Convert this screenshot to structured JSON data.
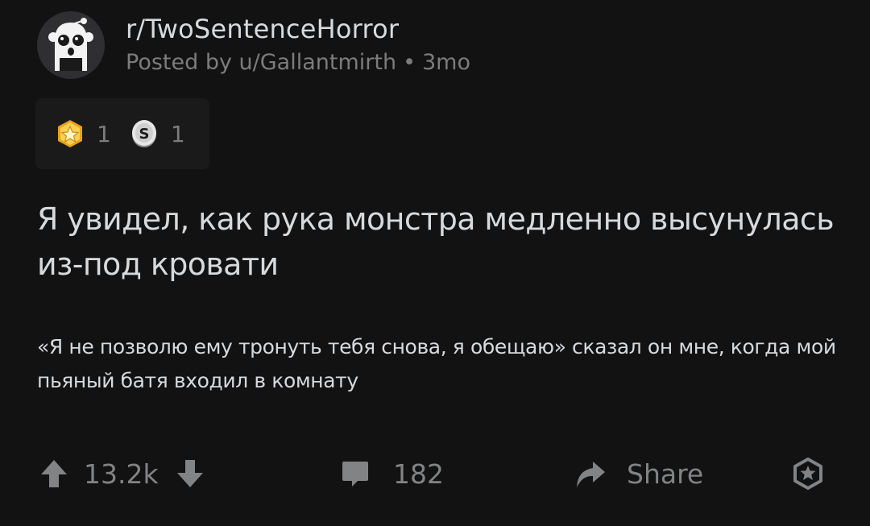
{
  "header": {
    "subreddit": "r/TwoSentenceHorror",
    "posted_by": "Posted by u/Gallantmirth",
    "separator": "•",
    "age": "3mo"
  },
  "awards": [
    {
      "icon": "star-award-icon",
      "count": "1"
    },
    {
      "icon": "silver-coin-award-icon",
      "count": "1"
    }
  ],
  "post": {
    "title": "Я увидел, как рука монстра медленно высунулась из-под кровати",
    "body": "«Я не позволю ему тронуть тебя снова, я обещаю» сказал он мне, когда мой пьяный батя входил в комнату"
  },
  "actions": {
    "score": "13.2k",
    "comments": "182",
    "share_label": "Share"
  },
  "colors": {
    "background": "#121213",
    "text": "#d7dadc",
    "muted": "#818384",
    "award_gold": "#f3c231"
  }
}
